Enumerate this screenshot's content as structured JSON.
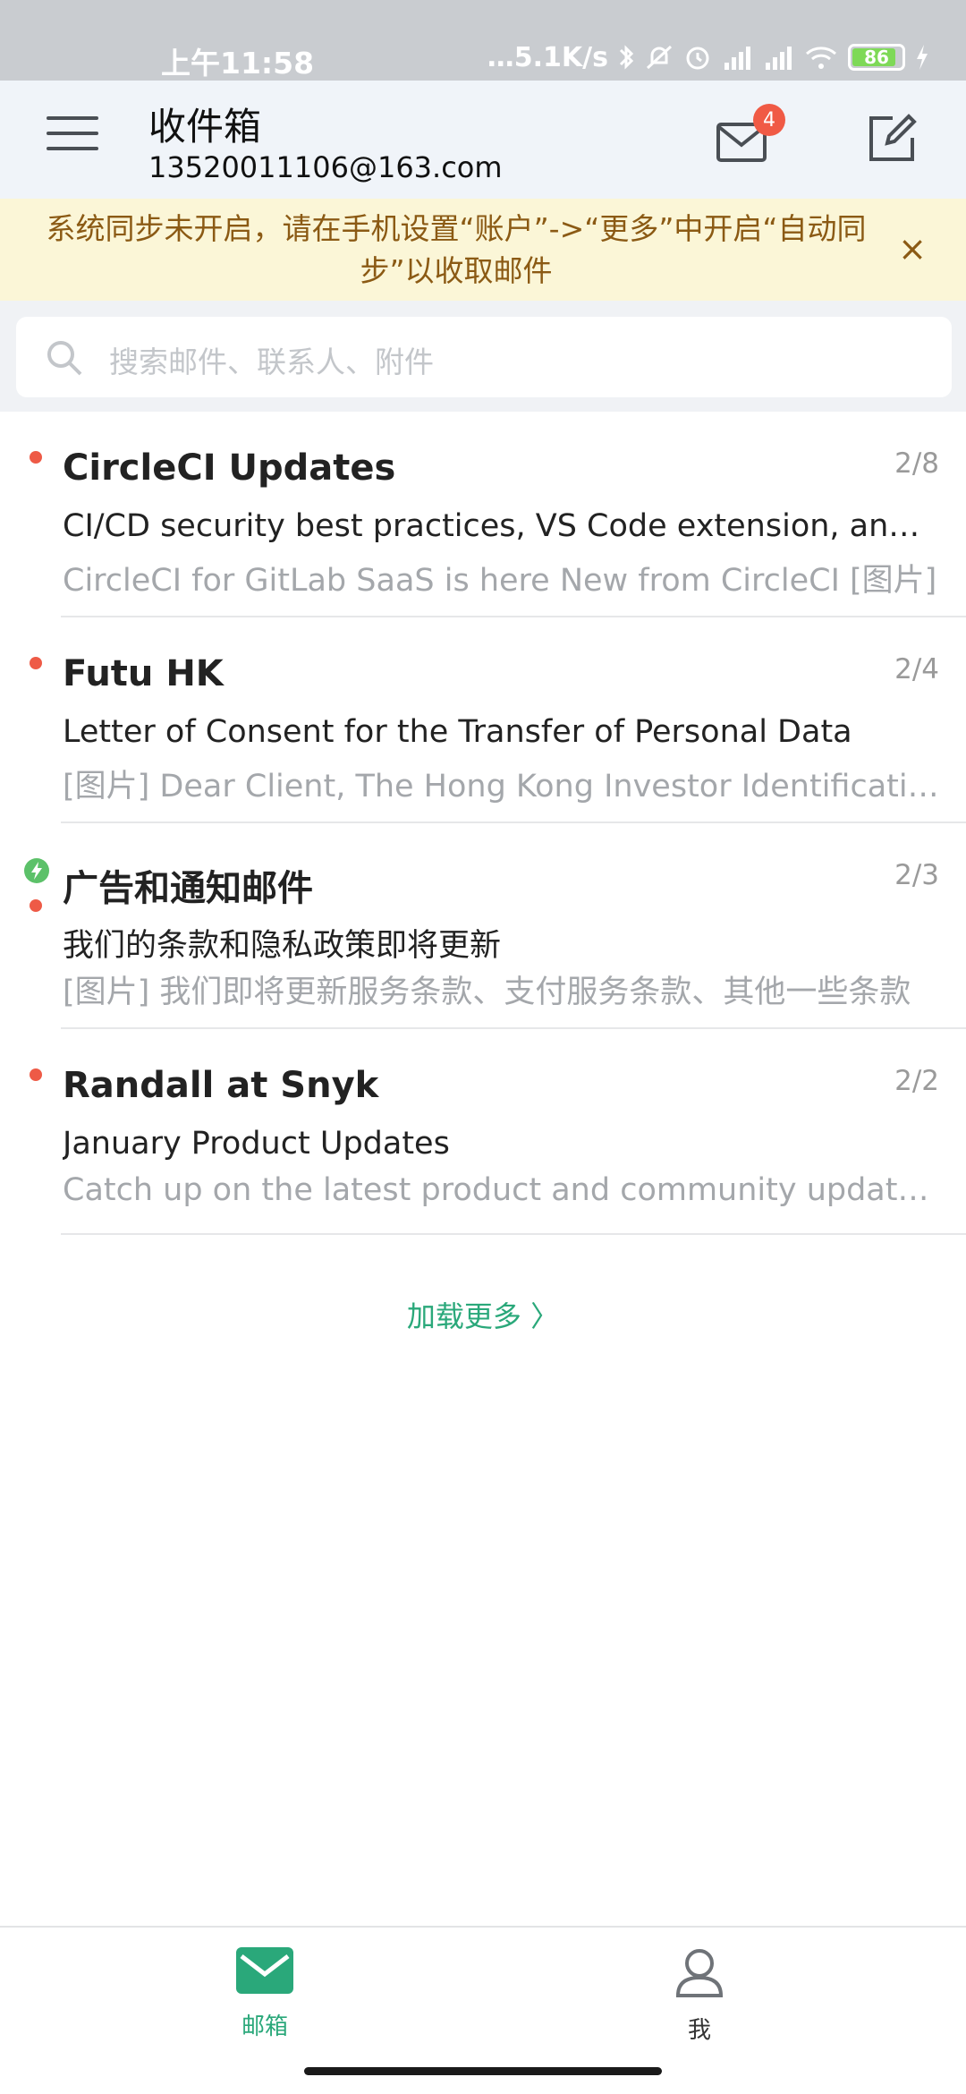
{
  "status_bar": {
    "time": "上午11:58",
    "network_speed": "5.1K/s",
    "battery": "86"
  },
  "header": {
    "title": "收件箱",
    "account": "13520011106@163.com",
    "unread_badge": "4"
  },
  "notice": {
    "text": "系统同步未开启，请在手机设置“账户”->“更多”中开启“自动同步”以收取邮件",
    "close_label": "×"
  },
  "search": {
    "placeholder": "搜索邮件、联系人、附件"
  },
  "mails": [
    {
      "sender": "CircleCI Updates",
      "date": "2/8",
      "subject": "CI/CD security best practices, VS Code extension, and more",
      "preview": "CircleCI for GitLab SaaS is here New from CircleCI [图片]"
    },
    {
      "sender": "Futu HK",
      "date": "2/4",
      "subject": "Letter of Consent for the Transfer of Personal Data",
      "preview": "[图片] Dear Client, The Hong Kong Investor Identification Regime"
    },
    {
      "sender": "广告和通知邮件",
      "date": "2/3",
      "subject": "我们的条款和隐私政策即将更新",
      "preview": "[图片] 我们即将更新服务条款、支付服务条款、其他一些条款"
    },
    {
      "sender": "Randall at Snyk",
      "date": "2/2",
      "subject": "January Product Updates",
      "preview": "Catch up on the latest product and community updates from Snyk"
    }
  ],
  "load_more": "加载更多 〉",
  "bottom_nav": {
    "mailbox_label": "邮箱",
    "me_label": "我"
  },
  "colors": {
    "accent": "#2aa87a",
    "unread_dot": "#ee5a46",
    "notice_bg": "#fbf6d7",
    "notice_text": "#8b5a14"
  }
}
